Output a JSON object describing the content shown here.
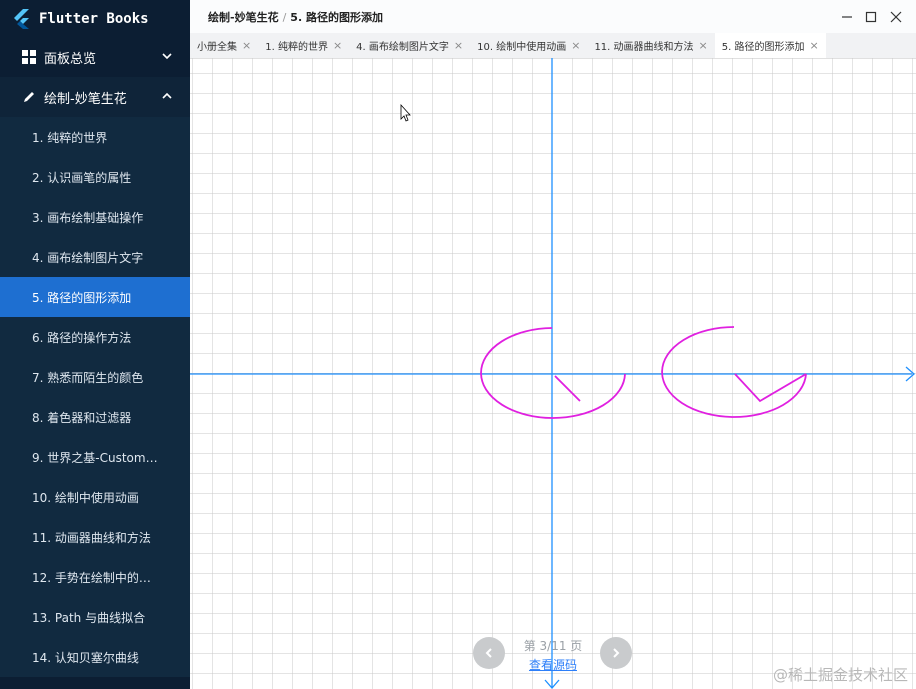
{
  "app": {
    "title": "Flutter Books"
  },
  "sidebar": {
    "groups": [
      {
        "label": "面板总览",
        "icon": "dashboard-icon"
      },
      {
        "label": "绘制-妙笔生花",
        "icon": "pen-icon"
      }
    ],
    "items": [
      {
        "label": "1. 纯粹的世界"
      },
      {
        "label": "2. 认识画笔的属性"
      },
      {
        "label": "3. 画布绘制基础操作"
      },
      {
        "label": "4. 画布绘制图片文字"
      },
      {
        "label": "5. 路径的图形添加"
      },
      {
        "label": "6. 路径的操作方法"
      },
      {
        "label": "7. 熟悉而陌生的颜色"
      },
      {
        "label": "8. 着色器和过滤器"
      },
      {
        "label": "9. 世界之基-Custom…"
      },
      {
        "label": "10. 绘制中使用动画"
      },
      {
        "label": "11. 动画器曲线和方法"
      },
      {
        "label": "12. 手势在绘制中的…"
      },
      {
        "label": "13. Path 与曲线拟合"
      },
      {
        "label": "14. 认知贝塞尔曲线"
      }
    ]
  },
  "titlebar": {
    "breadcrumb_parent": "绘制-妙笔生花",
    "breadcrumb_sep": "/",
    "breadcrumb_current": "5. 路径的图形添加"
  },
  "tabs": [
    {
      "label": "小册全集"
    },
    {
      "label": "1. 纯粹的世界"
    },
    {
      "label": "4. 画布绘制图片文字"
    },
    {
      "label": "10. 绘制中使用动画"
    },
    {
      "label": "11. 动画器曲线和方法"
    },
    {
      "label": "5. 路径的图形添加"
    }
  ],
  "pager": {
    "info": "第 3/11 页",
    "link": "查看源码"
  },
  "watermark": "@稀土掘金技术社区",
  "colors": {
    "sidebar_bg": "#0c1e33",
    "active_item": "#1e6fd1",
    "axis": "#1e90ff",
    "path": "#e020e0",
    "grid": "#c8c8c8"
  }
}
